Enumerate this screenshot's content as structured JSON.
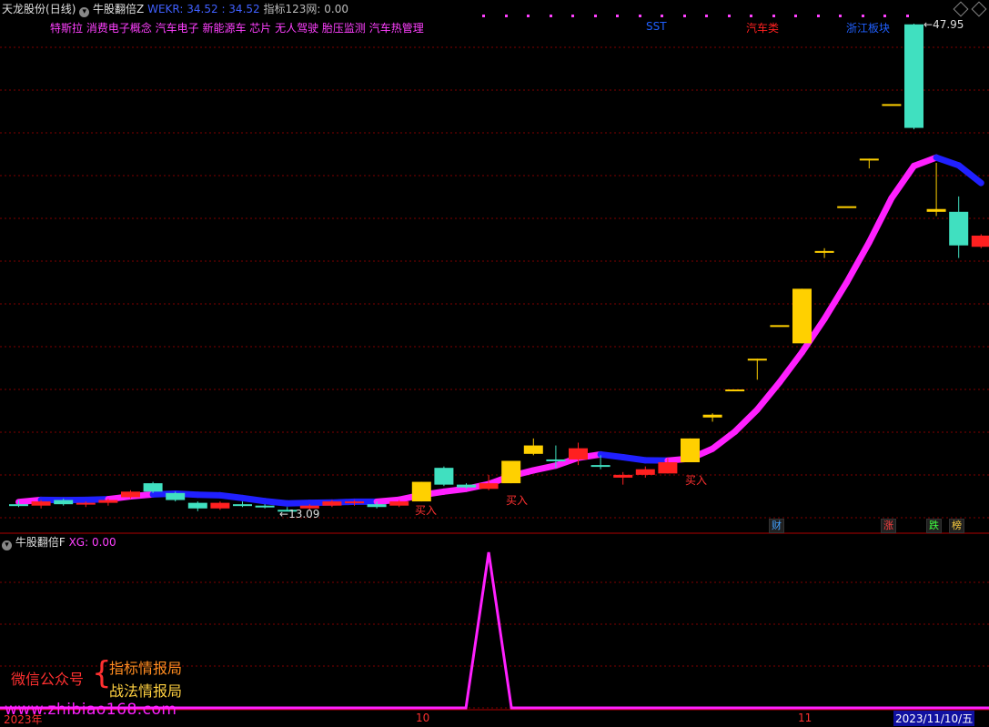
{
  "header": {
    "stock_name": "天龙股份",
    "period": "(日线)",
    "indicator_name": "牛股翻倍Z",
    "wekr_label": "WEKR: 34.52",
    "wekr_value2": ": 34.52",
    "index_label": "指标123网: 0.00"
  },
  "concepts": "特斯拉 消费电子概念 汽车电子 新能源车 芯片 无人驾驶 胎压监测 汽车热管理",
  "tags": {
    "sst": "SST",
    "auto": "汽车类",
    "zhejiang": "浙江板块"
  },
  "price_labels": {
    "high": "47.95",
    "low": "13.09"
  },
  "buy_label": "买入",
  "badges": {
    "cai": "财",
    "zhang": "涨",
    "die": "跌",
    "bang": "榜"
  },
  "sub_panel": {
    "name": "牛股翻倍F",
    "xg": "XG: 0.00"
  },
  "watermark": {
    "wechat": "微信公众号",
    "brace": "{",
    "line1": "指标情报局",
    "line2": "战法情报局",
    "url": "www.zhibiao168.com"
  },
  "axis": {
    "year": "2023年",
    "oct": "10",
    "nov": "11",
    "date": "2023/11/10/五"
  },
  "colors": {
    "up": "#ff2020",
    "down": "#40e0c0",
    "limit_up": "#ffd000",
    "ma_blue": "#2020ff",
    "ma_magenta": "#ff20ff",
    "bg": "#000000"
  },
  "chart_data": {
    "type": "candlestick",
    "price_range": [
      13.09,
      47.95
    ],
    "candles": [
      {
        "o": 13.6,
        "h": 13.9,
        "l": 13.4,
        "c": 13.5,
        "col": "down"
      },
      {
        "o": 13.5,
        "h": 13.9,
        "l": 13.3,
        "c": 13.8,
        "col": "up"
      },
      {
        "o": 13.9,
        "h": 14.0,
        "l": 13.5,
        "c": 13.6,
        "col": "down"
      },
      {
        "o": 13.6,
        "h": 13.8,
        "l": 13.4,
        "c": 13.7,
        "col": "up"
      },
      {
        "o": 13.7,
        "h": 14.0,
        "l": 13.5,
        "c": 13.9,
        "col": "up"
      },
      {
        "o": 14.1,
        "h": 14.6,
        "l": 14.0,
        "c": 14.5,
        "col": "up"
      },
      {
        "o": 15.1,
        "h": 15.2,
        "l": 14.4,
        "c": 14.5,
        "col": "down"
      },
      {
        "o": 14.4,
        "h": 14.5,
        "l": 13.8,
        "c": 13.9,
        "col": "down"
      },
      {
        "o": 13.7,
        "h": 13.8,
        "l": 13.1,
        "c": 13.3,
        "col": "down"
      },
      {
        "o": 13.3,
        "h": 13.8,
        "l": 13.2,
        "c": 13.7,
        "col": "up"
      },
      {
        "o": 13.6,
        "h": 13.8,
        "l": 13.4,
        "c": 13.5,
        "col": "down"
      },
      {
        "o": 13.5,
        "h": 13.6,
        "l": 13.3,
        "c": 13.4,
        "col": "down"
      },
      {
        "o": 13.2,
        "h": 13.4,
        "l": 13.09,
        "c": 13.1,
        "col": "down"
      },
      {
        "o": 13.3,
        "h": 13.6,
        "l": 13.2,
        "c": 13.5,
        "col": "up"
      },
      {
        "o": 13.5,
        "h": 13.9,
        "l": 13.4,
        "c": 13.8,
        "col": "up"
      },
      {
        "o": 13.7,
        "h": 13.9,
        "l": 13.5,
        "c": 13.8,
        "col": "up"
      },
      {
        "o": 13.6,
        "h": 13.8,
        "l": 13.3,
        "c": 13.4,
        "col": "down"
      },
      {
        "o": 13.5,
        "h": 13.9,
        "l": 13.4,
        "c": 13.8,
        "col": "up"
      },
      {
        "o": 13.8,
        "h": 15.2,
        "l": 13.8,
        "c": 15.2,
        "col": "limit_up"
      },
      {
        "o": 16.2,
        "h": 16.3,
        "l": 14.9,
        "c": 15.0,
        "col": "down"
      },
      {
        "o": 15.0,
        "h": 15.1,
        "l": 14.7,
        "c": 14.8,
        "col": "down"
      },
      {
        "o": 14.7,
        "h": 15.7,
        "l": 14.6,
        "c": 15.1,
        "col": "up"
      },
      {
        "o": 15.1,
        "h": 16.7,
        "l": 15.1,
        "c": 16.7,
        "col": "limit_up"
      },
      {
        "o": 17.8,
        "h": 18.3,
        "l": 17.1,
        "c": 17.2,
        "col": "limit_up"
      },
      {
        "o": 16.8,
        "h": 17.8,
        "l": 16.2,
        "c": 16.7,
        "col": "down"
      },
      {
        "o": 16.8,
        "h": 18.0,
        "l": 16.4,
        "c": 17.6,
        "col": "up"
      },
      {
        "o": 16.4,
        "h": 17.1,
        "l": 16.1,
        "c": 16.3,
        "col": "down"
      },
      {
        "o": 15.5,
        "h": 15.9,
        "l": 15.0,
        "c": 15.7,
        "col": "up"
      },
      {
        "o": 15.7,
        "h": 16.3,
        "l": 15.5,
        "c": 16.1,
        "col": "up"
      },
      {
        "o": 15.8,
        "h": 16.9,
        "l": 15.8,
        "c": 16.6,
        "col": "up"
      },
      {
        "o": 16.6,
        "h": 18.3,
        "l": 16.6,
        "c": 18.3,
        "col": "limit_up"
      },
      {
        "o": 20.0,
        "h": 20.1,
        "l": 19.5,
        "c": 19.8,
        "col": "limit_up"
      },
      {
        "o": 21.8,
        "h": 21.8,
        "l": 21.8,
        "c": 21.8,
        "col": "limit_up"
      },
      {
        "o": 24.0,
        "h": 24.0,
        "l": 22.5,
        "c": 24.0,
        "col": "limit_up"
      },
      {
        "o": 26.4,
        "h": 26.4,
        "l": 26.4,
        "c": 26.4,
        "col": "limit_up"
      },
      {
        "o": 25.1,
        "h": 29.0,
        "l": 25.1,
        "c": 29.0,
        "col": "limit_up"
      },
      {
        "o": 31.7,
        "h": 31.9,
        "l": 31.2,
        "c": 31.7,
        "col": "limit_up"
      },
      {
        "o": 34.9,
        "h": 34.9,
        "l": 34.9,
        "c": 34.9,
        "col": "limit_up"
      },
      {
        "o": 38.3,
        "h": 38.3,
        "l": 37.6,
        "c": 38.3,
        "col": "limit_up"
      },
      {
        "o": 42.2,
        "h": 42.2,
        "l": 42.2,
        "c": 42.2,
        "col": "limit_up"
      },
      {
        "o": 47.9,
        "h": 47.95,
        "l": 40.4,
        "c": 40.5,
        "col": "down"
      },
      {
        "o": 34.5,
        "h": 38.0,
        "l": 34.2,
        "c": 34.7,
        "col": "limit_up"
      },
      {
        "o": 34.5,
        "h": 35.6,
        "l": 31.2,
        "c": 32.1,
        "col": "down"
      },
      {
        "o": 32.8,
        "h": 32.9,
        "l": 31.9,
        "c": 32.0,
        "col": "up"
      }
    ],
    "buy_signals": [
      18,
      22,
      30
    ],
    "xg_signal_index": 21
  }
}
